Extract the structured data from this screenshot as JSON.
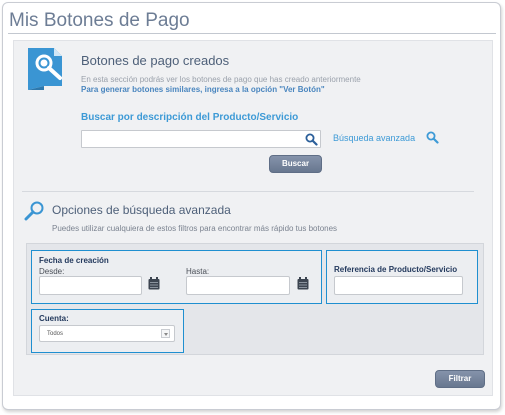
{
  "page": {
    "title": "Mis Botones de Pago"
  },
  "created": {
    "title": "Botones de pago creados",
    "desc_line1": "En esta sección podrás ver los botones de pago que has creado anteriormente",
    "desc_line2": "Para generar botones similares, ingresa a la opción \"Ver Botón\""
  },
  "search": {
    "label": "Buscar por descripción del Producto/Servicio",
    "value": "",
    "advanced_link": "Búsqueda avanzada",
    "button": "Buscar"
  },
  "advanced": {
    "title": "Opciones de búsqueda avanzada",
    "desc": "Puedes utilizar cualquiera de estos filtros para encontrar más rápido tus botones",
    "fecha": {
      "title": "Fecha de creación",
      "desde_label": "Desde:",
      "hasta_label": "Hasta:",
      "desde_value": "",
      "hasta_value": ""
    },
    "referencia": {
      "title": "Referencia de Producto/Servicio",
      "value": ""
    },
    "cuenta": {
      "title": "Cuenta:",
      "selected": "Todos"
    },
    "filter_button": "Filtrar"
  },
  "colors": {
    "accent": "#1f8fd0",
    "link": "#3d9ad6",
    "button": "#6f7e96",
    "title": "#6d7d95"
  },
  "icons": [
    "document-search-icon",
    "search-icon",
    "magnifier-icon",
    "calendar-icon",
    "dropdown-arrow-icon"
  ]
}
